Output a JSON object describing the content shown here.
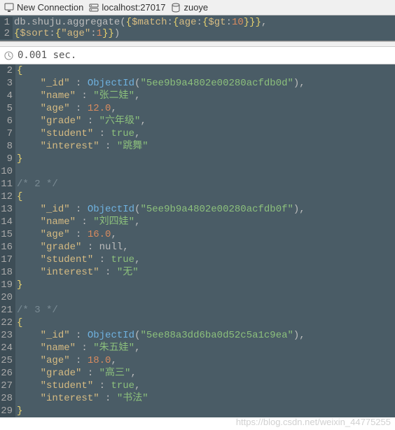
{
  "toolbar": {
    "new_connection": "New Connection",
    "host": "localhost:27017",
    "db": "zuoye"
  },
  "query": {
    "lines": [
      {
        "n": "1",
        "db": "db",
        "coll": "shuju",
        "fn": "aggregate",
        "match_age_gt": "10"
      },
      {
        "n": "2",
        "sort_field": "age",
        "sort_dir": "1"
      }
    ]
  },
  "timing": "0.001 sec.",
  "results": [
    {
      "n": "2",
      "type": "brace-open"
    },
    {
      "n": "3",
      "type": "id",
      "val": "5ee9b9a4802e00280acfdb0d"
    },
    {
      "n": "4",
      "type": "kvstr",
      "key": "name",
      "val": "张二娃"
    },
    {
      "n": "5",
      "type": "kvnum",
      "key": "age",
      "val": "12.0"
    },
    {
      "n": "6",
      "type": "kvstr",
      "key": "grade",
      "val": "六年级"
    },
    {
      "n": "7",
      "type": "kvbool",
      "key": "student",
      "val": "true"
    },
    {
      "n": "8",
      "type": "kvstr-last",
      "key": "interest",
      "val": "跳舞"
    },
    {
      "n": "9",
      "type": "brace-close"
    },
    {
      "n": "10",
      "type": "blank"
    },
    {
      "n": "11",
      "type": "comment",
      "val": "/* 2 */"
    },
    {
      "n": "12",
      "type": "brace-open"
    },
    {
      "n": "13",
      "type": "id",
      "val": "5ee9b9a4802e00280acfdb0f"
    },
    {
      "n": "14",
      "type": "kvstr",
      "key": "name",
      "val": "刘四娃"
    },
    {
      "n": "15",
      "type": "kvnum",
      "key": "age",
      "val": "16.0"
    },
    {
      "n": "16",
      "type": "kvnull",
      "key": "grade"
    },
    {
      "n": "17",
      "type": "kvbool",
      "key": "student",
      "val": "true"
    },
    {
      "n": "18",
      "type": "kvstr-last",
      "key": "interest",
      "val": "无"
    },
    {
      "n": "19",
      "type": "brace-close"
    },
    {
      "n": "20",
      "type": "blank"
    },
    {
      "n": "21",
      "type": "comment",
      "val": "/* 3 */"
    },
    {
      "n": "22",
      "type": "brace-open"
    },
    {
      "n": "23",
      "type": "id",
      "val": "5ee88a3dd6ba0d52c5a1c9ea"
    },
    {
      "n": "24",
      "type": "kvstr",
      "key": "name",
      "val": "朱五娃"
    },
    {
      "n": "25",
      "type": "kvnum",
      "key": "age",
      "val": "18.0"
    },
    {
      "n": "26",
      "type": "kvstr",
      "key": "grade",
      "val": "高三"
    },
    {
      "n": "27",
      "type": "kvbool",
      "key": "student",
      "val": "true"
    },
    {
      "n": "28",
      "type": "kvstr-last",
      "key": "interest",
      "val": "书法"
    },
    {
      "n": "29",
      "type": "brace-close-partial"
    }
  ],
  "watermark": "https://blog.csdn.net/weixin_44775255"
}
